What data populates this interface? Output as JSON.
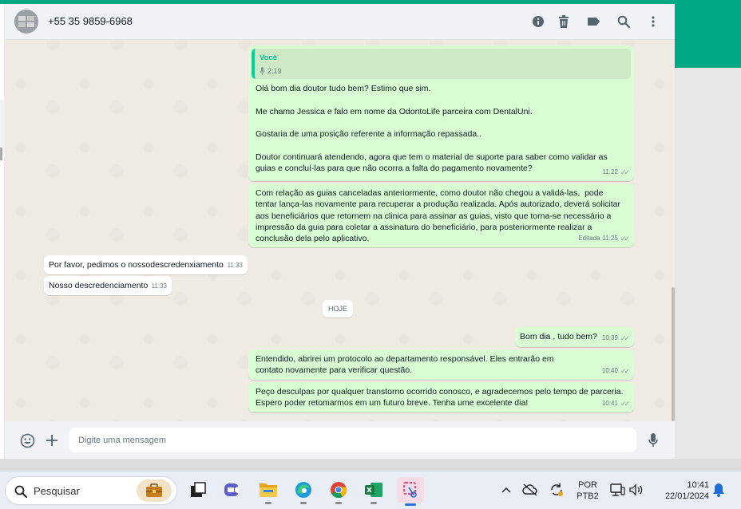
{
  "header": {
    "contact_name": "+55 35 9859-6968",
    "icons": [
      "info-icon",
      "trash-icon",
      "label-icon",
      "search-icon",
      "more-vertical-icon"
    ]
  },
  "messages": [
    {
      "direction": "out",
      "quote": {
        "author": "Você",
        "duration": "2:19",
        "icon": "mic-icon"
      },
      "text": "Olá bom dia doutor tudo bem? Estimo que sim.\n\nMe chamo Jessica e falo em nome da OdontoLife parceira com DentalUni.\n\nGostaria de uma posição referente a informação repassada..\n\nDoutor continuará atendendo, agora que tem o material de suporte para saber como validar as guias e concluí-las para que não ocorra a falta do pagamento novamente?",
      "time": "11:22"
    },
    {
      "direction": "out",
      "text": "Com relação as guias canceladas anteriormente, como doutor não chegou a validá-las,  pode tentar lança-las novamente para recuperar a produção realizada. Após autorizado, deverá solicitar aos beneficiários que retornem na clinica para assinar as guias, visto que torna-se necessário a impressão da guia para coletar a assinatura do beneficiário, para posteriormente realizar a conclusão dela pelo aplicativo.",
      "edited_label": "Editada",
      "time": "11:25"
    },
    {
      "direction": "in",
      "text": "Por favor, pedimos o nossodescredenxiamento",
      "time": "11:33"
    },
    {
      "direction": "in",
      "text": "Nosso descredenciamento",
      "time": "11:33"
    },
    {
      "direction": "out",
      "text": "Bom dia , tudo bem?",
      "time": "10:39"
    },
    {
      "direction": "out",
      "text": "Entendido, abrirei um protocolo ao departamento responsável. Eles entrarão em contato novamente para verificar questão.",
      "time": "10:40"
    },
    {
      "direction": "out",
      "text": "Peço desculpas por qualquer transtorno ocorrido conosco, e agradecemos pelo tempo de parceria. Espero poder retomarmos em um futuro breve. Tenha ume excelente dia!",
      "time": "10:41"
    }
  ],
  "day_separator": "HOJE",
  "composer": {
    "placeholder": "Digite uma mensagem",
    "icons": [
      "emoji-icon",
      "plus-icon",
      "mic-icon"
    ]
  },
  "taskbar": {
    "search_label": "Pesquisar",
    "apps": [
      "briefcase-icon",
      "task-view-icon",
      "teams-icon",
      "file-explorer-icon",
      "edge-icon",
      "chrome-icon",
      "excel-icon",
      "snipping-tool-icon"
    ],
    "language_top": "POR",
    "language_bottom": "PTB2",
    "time": "10:41",
    "date": "22/01/2024"
  },
  "colors": {
    "brand_green": "#00a884",
    "outgoing_bubble": "#d9fdd3",
    "incoming_bubble": "#ffffff",
    "chat_background": "#efeae2",
    "quote_accent": "#06cf9c"
  }
}
